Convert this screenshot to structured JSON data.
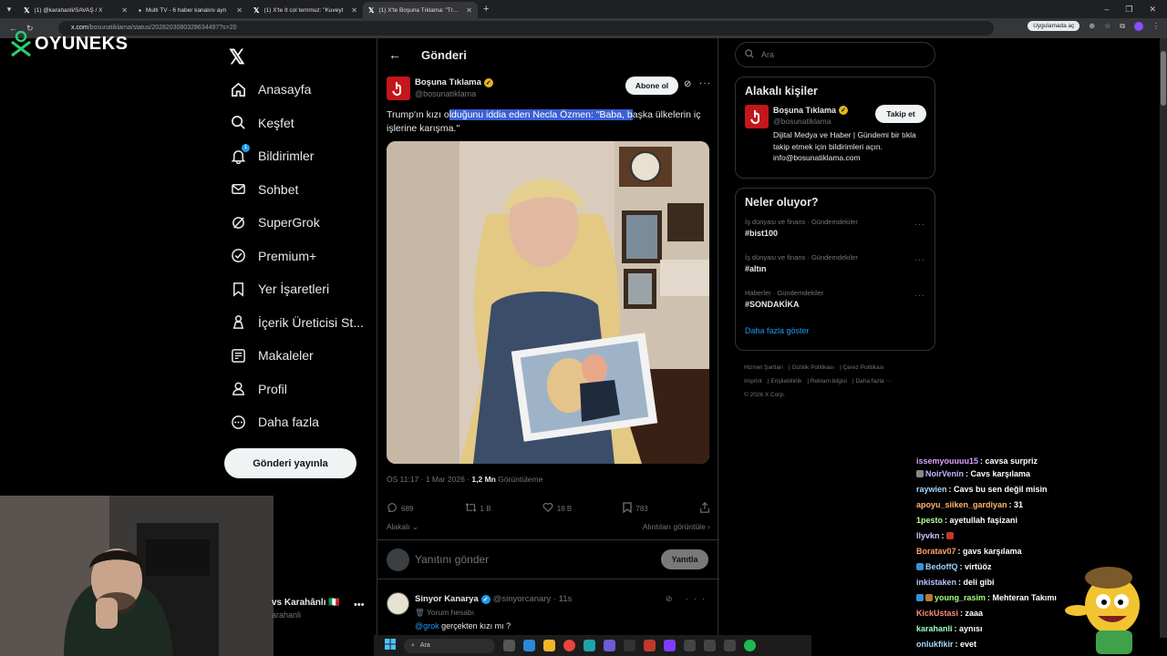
{
  "browser": {
    "tabs": [
      {
        "label": "(1) @karahanli/SAVAŞ / X",
        "active": false
      },
      {
        "label": "Multi TV - 6 haber kanalını ayn",
        "active": false
      },
      {
        "label": "(1) X'te İt col temmuz: \"Kuveyt",
        "active": false
      },
      {
        "label": "(1) X'te Boşuna Tıklama: \"Trump",
        "active": true
      }
    ],
    "url_domain": "x.com",
    "url_path": "/bosunatiklama/status/2028203080328634497?s=20",
    "app_chip": "Uygulamada aç"
  },
  "overlay": {
    "logo_text": "OYUNEKS"
  },
  "nav": {
    "items": [
      {
        "label": "Anasayfa",
        "icon": "home-icon"
      },
      {
        "label": "Keşfet",
        "icon": "search-icon"
      },
      {
        "label": "Bildirimler",
        "icon": "bell-icon",
        "badge": "1"
      },
      {
        "label": "Sohbet",
        "icon": "mail-icon"
      },
      {
        "label": "SuperGrok",
        "icon": "grok-icon"
      },
      {
        "label": "Premium+",
        "icon": "verified-icon"
      },
      {
        "label": "Yer İşaretleri",
        "icon": "bookmark-icon"
      },
      {
        "label": "İçerik Üreticisi St...",
        "icon": "creator-icon"
      },
      {
        "label": "Makaleler",
        "icon": "articles-icon"
      },
      {
        "label": "Profil",
        "icon": "profile-icon"
      },
      {
        "label": "Daha fazla",
        "icon": "more-icon"
      }
    ],
    "post_button": "Gönderi yayınla",
    "account_name": "vs Karahânlı 🇮🇹",
    "account_handle": "arahanli"
  },
  "main": {
    "header_title": "Gönderi",
    "author_name": "Boşuna Tıklama",
    "author_handle": "@bosunatiklama",
    "subscribe_label": "Abone ol",
    "tweet_pre": "Trump'ın kızı o",
    "tweet_highlight": "lduğunu iddia eden Necla Özmen: \"Baba, b",
    "tweet_post": "aşka ülkelerin iç işlerine karışma.\"",
    "meta_time": "ÖS 11:17 · 1 Mar 2026 · ",
    "meta_views": "1,2 Mn",
    "meta_views_label": " Görüntüleme",
    "replies": "689",
    "reposts": "1 B",
    "likes": "18 B",
    "bookmarks": "783",
    "sort_label": "Alakalı",
    "quotes_label": "Alıntıları görüntüle",
    "reply_placeholder": "Yanıtını gönder",
    "reply_button": "Yanıtla",
    "reply": {
      "name": "Sinyor Kanarya",
      "handle": "@sinyorcanary · 11s",
      "note": "🗑 Yorum hesabı",
      "mention": "@grok",
      "text": " gerçekten kızı mı ?"
    }
  },
  "sidebar": {
    "search_placeholder": "Ara",
    "related_title": "Alakalı kişiler",
    "related_name": "Boşuna Tıklama",
    "related_handle": "@bosunatiklama",
    "related_bio": "Dijital Medya ve Haber | Gündemi bir tıkla takip etmek için bildirimleri açın. info@bosunatiklama.com",
    "follow_label": "Takip et",
    "trends_title": "Neler oluyor?",
    "trends": [
      {
        "category": "İş dünyası ve finans · Gündemdekiler",
        "topic": "#bist100"
      },
      {
        "category": "İş dünyası ve finans · Gündemdekiler",
        "topic": "#altın"
      },
      {
        "category": "Haberler · Gündemdekiler",
        "topic": "#SONDAKİKA"
      }
    ],
    "show_more": "Daha fazla göster",
    "footer": [
      "Hizmet Şartları",
      "Gizlilik Politikası",
      "Çerez Politikası",
      "Imprint",
      "Erişilebilirlik",
      "Reklam bilgisi",
      "Daha fazla ···",
      "© 2026 X Corp."
    ]
  },
  "chat": [
    {
      "user": "issemyouuuu15",
      "text": " : cavsa surpriz",
      "color": "#d6a0ff"
    },
    {
      "user": "NoirVenin",
      "text": " : Cavs karşılama",
      "color": "#c6b3ff"
    },
    {
      "user": "raywien",
      "text": " : Cavs bu sen değil misin",
      "color": "#a5d8ff"
    },
    {
      "user": "apoyu_siiken_gardiyan",
      "text": " : 31",
      "color": "#ffb86b"
    },
    {
      "user": "1pesto",
      "text": " : ayetullah faşizani",
      "color": "#b8ff9c"
    },
    {
      "user": "llyvkn",
      "text": " : ",
      "color": "#c9c9ff"
    },
    {
      "user": "Boratav07",
      "text": " : gavs karşılama",
      "color": "#ffa36b"
    },
    {
      "user": "BedoffQ",
      "text": " : virtüöz",
      "color": "#9cd0ff"
    },
    {
      "user": "inkistaken",
      "text": " : deli gibi",
      "color": "#b3c7ff"
    },
    {
      "user": "young_rasim",
      "text": " : Mehteran Takımı",
      "color": "#a6ff7a"
    },
    {
      "user": "KickUstasi",
      "text": " : zaaa",
      "color": "#ff8a7a"
    },
    {
      "user": "karahanli",
      "text": " : aynısı",
      "color": "#9affc0"
    },
    {
      "user": "onlukfikir",
      "text": " : evet",
      "color": "#a5d8ff"
    }
  ],
  "taskbar": {
    "search_label": "Ara"
  }
}
